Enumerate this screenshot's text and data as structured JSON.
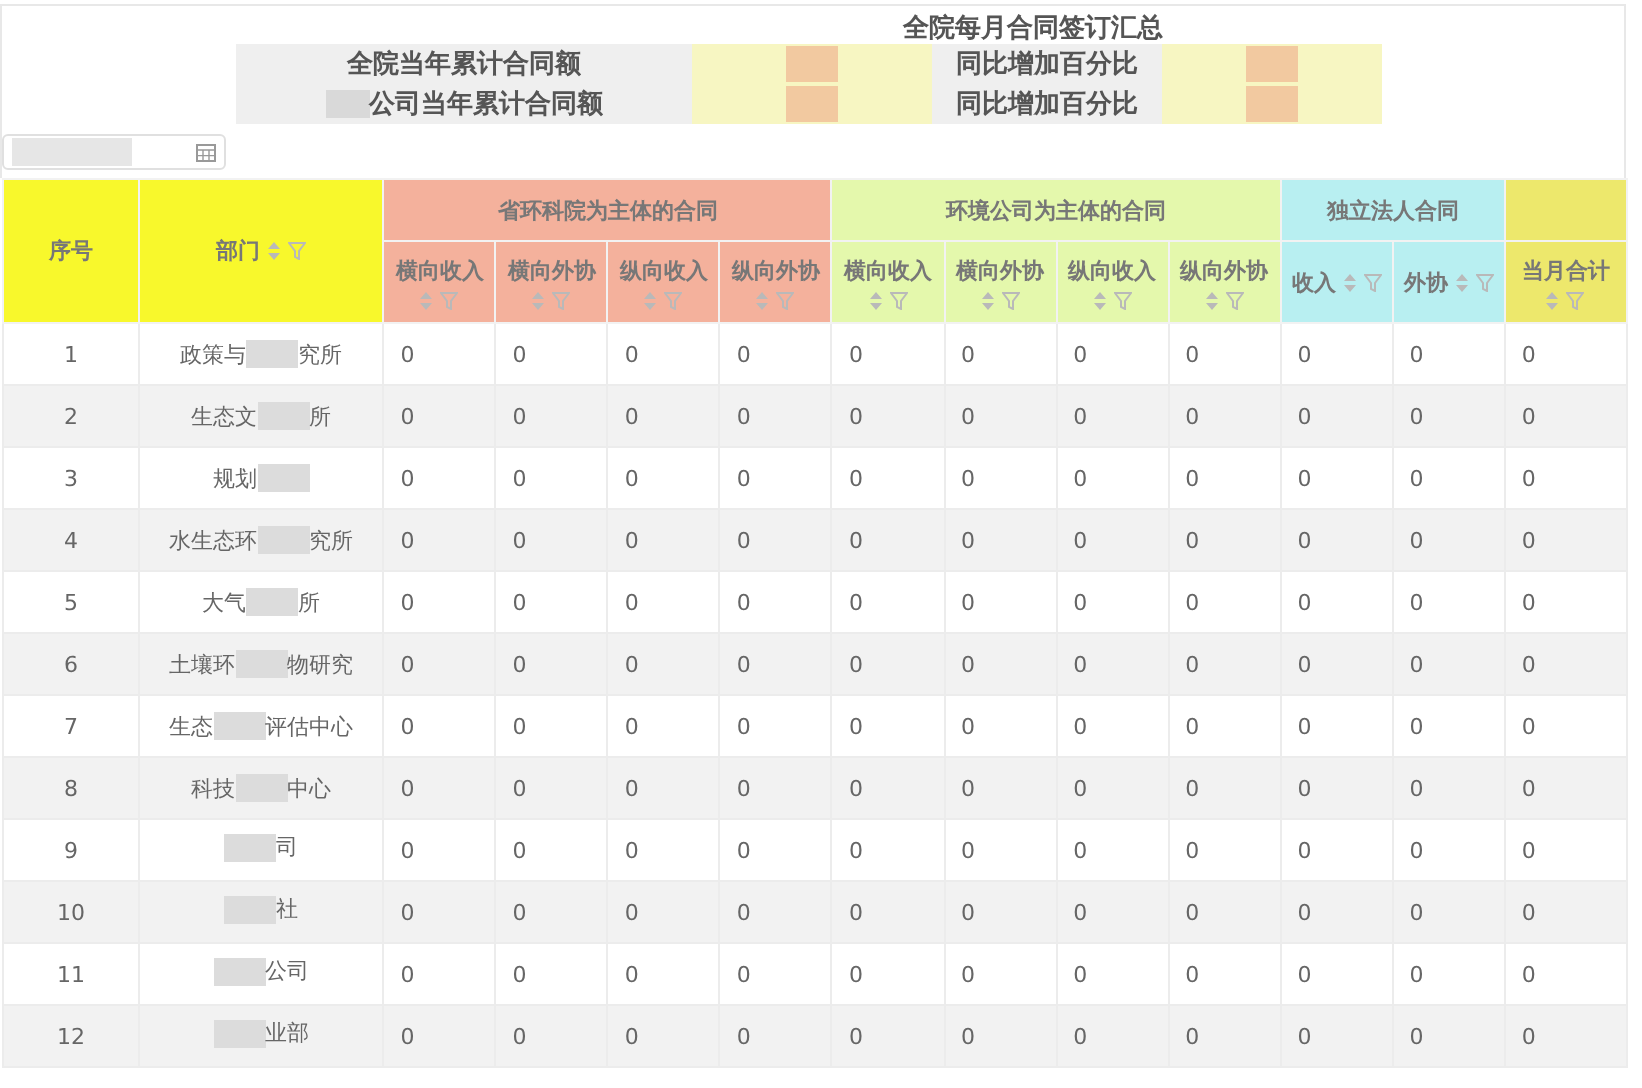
{
  "title": "全院每月合同签订汇总",
  "summary": [
    {
      "label": [
        {
          "kind": "text",
          "text": "全院当年累计合同额"
        }
      ],
      "value": {
        "kind": "redacted"
      },
      "ratio_label": "同比增加百分比",
      "ratio_value": {
        "kind": "redacted"
      }
    },
    {
      "label": [
        {
          "kind": "redacted"
        },
        {
          "kind": "text",
          "text": "公司当年累计合同额"
        }
      ],
      "value": {
        "kind": "redacted"
      },
      "ratio_label": "同比增加百分比",
      "ratio_value": {
        "kind": "redacted"
      }
    }
  ],
  "date_field": {
    "value": {
      "kind": "redacted"
    }
  },
  "table": {
    "fixed_columns": [
      {
        "label": "序号",
        "sort_filter": false
      },
      {
        "label": "部门",
        "sort_filter": true
      }
    ],
    "groups": [
      {
        "label": "省环科院为主体的合同",
        "color": "#f4b19c",
        "columns": [
          {
            "label": "横向收入",
            "sort_filter": true
          },
          {
            "label": "横向外协",
            "sort_filter": true
          },
          {
            "label": "纵向收入",
            "sort_filter": true
          },
          {
            "label": "纵向外协",
            "sort_filter": true
          }
        ]
      },
      {
        "label": "环境公司为主体的合同",
        "color": "#e4f8ac",
        "columns": [
          {
            "label": "横向收入",
            "sort_filter": true
          },
          {
            "label": "横向外协",
            "sort_filter": true
          },
          {
            "label": "纵向收入",
            "sort_filter": true
          },
          {
            "label": "纵向外协",
            "sort_filter": true
          }
        ]
      },
      {
        "label": "独立法人合同",
        "color": "#b8eff1",
        "columns": [
          {
            "label": "收入",
            "sort_filter": true
          },
          {
            "label": "外协",
            "sort_filter": true
          }
        ]
      },
      {
        "color": "#ede86c",
        "columns": [
          {
            "label": "当月合计",
            "sort_filter": true
          }
        ]
      }
    ],
    "rows": [
      {
        "index": "1",
        "dept": [
          {
            "kind": "text",
            "text": "政策与"
          },
          {
            "kind": "redacted"
          },
          {
            "kind": "text",
            "text": "究所"
          }
        ],
        "values": [
          "0",
          "0",
          "0",
          "0",
          "0",
          "0",
          "0",
          "0",
          "0",
          "0",
          "0"
        ]
      },
      {
        "index": "2",
        "dept": [
          {
            "kind": "text",
            "text": "生态文"
          },
          {
            "kind": "redacted"
          },
          {
            "kind": "text",
            "text": "所"
          }
        ],
        "values": [
          "0",
          "0",
          "0",
          "0",
          "0",
          "0",
          "0",
          "0",
          "0",
          "0",
          "0"
        ]
      },
      {
        "index": "3",
        "dept": [
          {
            "kind": "text",
            "text": "规划"
          },
          {
            "kind": "redacted"
          }
        ],
        "values": [
          "0",
          "0",
          "0",
          "0",
          "0",
          "0",
          "0",
          "0",
          "0",
          "0",
          "0"
        ]
      },
      {
        "index": "4",
        "dept": [
          {
            "kind": "text",
            "text": "水生态环"
          },
          {
            "kind": "redacted"
          },
          {
            "kind": "text",
            "text": "究所"
          }
        ],
        "values": [
          "0",
          "0",
          "0",
          "0",
          "0",
          "0",
          "0",
          "0",
          "0",
          "0",
          "0"
        ]
      },
      {
        "index": "5",
        "dept": [
          {
            "kind": "text",
            "text": "大气"
          },
          {
            "kind": "redacted"
          },
          {
            "kind": "text",
            "text": "所"
          }
        ],
        "values": [
          "0",
          "0",
          "0",
          "0",
          "0",
          "0",
          "0",
          "0",
          "0",
          "0",
          "0"
        ]
      },
      {
        "index": "6",
        "dept": [
          {
            "kind": "text",
            "text": "土壤环"
          },
          {
            "kind": "redacted"
          },
          {
            "kind": "text",
            "text": "物研究"
          }
        ],
        "values": [
          "0",
          "0",
          "0",
          "0",
          "0",
          "0",
          "0",
          "0",
          "0",
          "0",
          "0"
        ]
      },
      {
        "index": "7",
        "dept": [
          {
            "kind": "text",
            "text": "生态"
          },
          {
            "kind": "redacted"
          },
          {
            "kind": "text",
            "text": "评估中心"
          }
        ],
        "values": [
          "0",
          "0",
          "0",
          "0",
          "0",
          "0",
          "0",
          "0",
          "0",
          "0",
          "0"
        ]
      },
      {
        "index": "8",
        "dept": [
          {
            "kind": "text",
            "text": "科技"
          },
          {
            "kind": "redacted"
          },
          {
            "kind": "text",
            "text": "中心"
          }
        ],
        "values": [
          "0",
          "0",
          "0",
          "0",
          "0",
          "0",
          "0",
          "0",
          "0",
          "0",
          "0"
        ]
      },
      {
        "index": "9",
        "dept": [
          {
            "kind": "redacted"
          },
          {
            "kind": "text",
            "text": "司"
          }
        ],
        "values": [
          "0",
          "0",
          "0",
          "0",
          "0",
          "0",
          "0",
          "0",
          "0",
          "0",
          "0"
        ]
      },
      {
        "index": "10",
        "dept": [
          {
            "kind": "redacted"
          },
          {
            "kind": "text",
            "text": "社"
          }
        ],
        "values": [
          "0",
          "0",
          "0",
          "0",
          "0",
          "0",
          "0",
          "0",
          "0",
          "0",
          "0"
        ]
      },
      {
        "index": "11",
        "dept": [
          {
            "kind": "redacted"
          },
          {
            "kind": "text",
            "text": "公司"
          }
        ],
        "values": [
          "0",
          "0",
          "0",
          "0",
          "0",
          "0",
          "0",
          "0",
          "0",
          "0",
          "0"
        ]
      },
      {
        "index": "12",
        "dept": [
          {
            "kind": "redacted"
          },
          {
            "kind": "text",
            "text": "业部"
          }
        ],
        "values": [
          "0",
          "0",
          "0",
          "0",
          "0",
          "0",
          "0",
          "0",
          "0",
          "0",
          "0"
        ]
      }
    ]
  }
}
